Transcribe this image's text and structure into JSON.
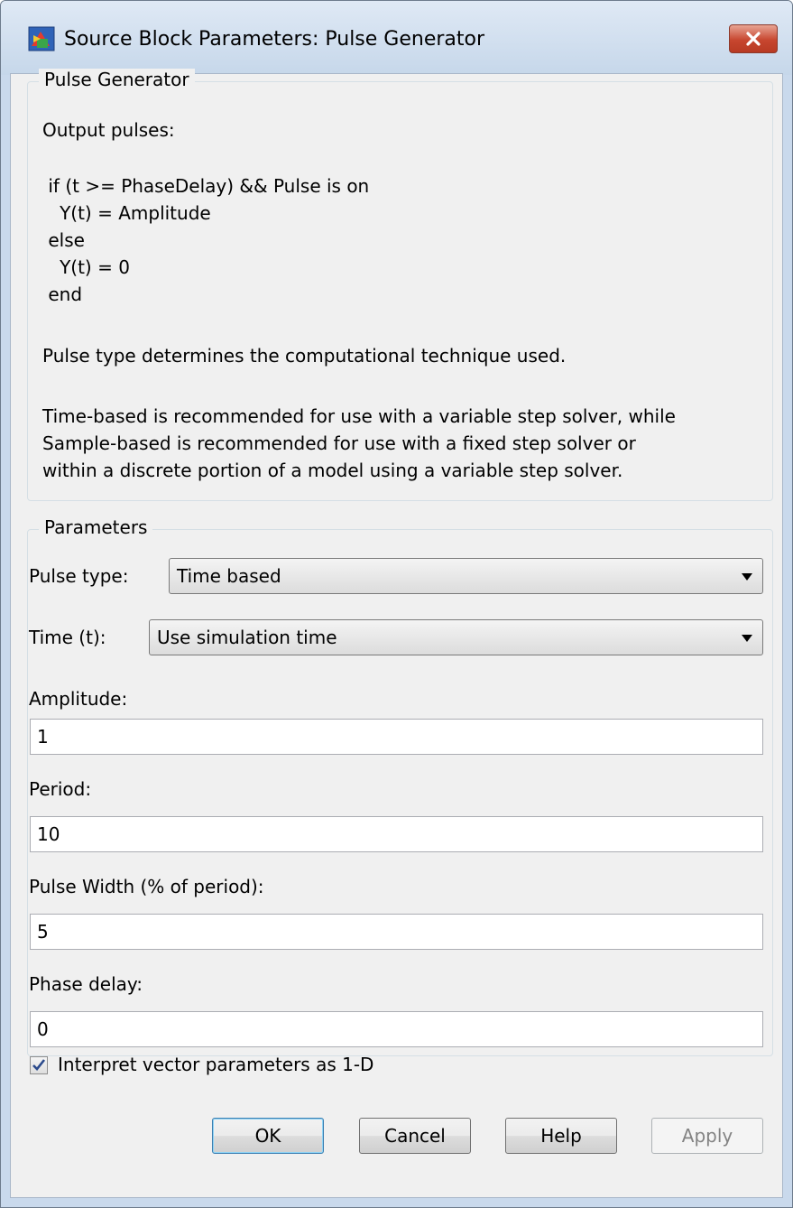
{
  "window": {
    "title": "Source Block Parameters: Pulse Generator",
    "close_icon": "close-x-icon",
    "app_icon": "simulink-block-icon"
  },
  "description": {
    "legend": "Pulse Generator",
    "intro": "Output pulses:",
    "code_lines": [
      " if (t >= PhaseDelay) && Pulse is on",
      "   Y(t) = Amplitude",
      " else",
      "   Y(t) = 0",
      " end"
    ],
    "pulse_type_note": "Pulse type determines the computational technique used.",
    "recommend_lines": [
      "Time-based is recommended for use with a variable step solver, while",
      "Sample-based is recommended for use with a fixed step solver or",
      "within a discrete portion of a model using a variable step solver."
    ]
  },
  "parameters": {
    "legend": "Parameters",
    "pulse_type": {
      "label": "Pulse type:",
      "value": "Time based"
    },
    "time": {
      "label": "Time (t):",
      "value": "Use simulation time"
    },
    "amplitude": {
      "label": "Amplitude:",
      "value": "1"
    },
    "period": {
      "label": "Period:",
      "value": "10"
    },
    "pulse_width": {
      "label": "Pulse Width (% of period):",
      "value": "5"
    },
    "phase_delay": {
      "label": "Phase delay:",
      "value": "0"
    },
    "interpret_vector": {
      "label": "Interpret vector parameters as 1-D",
      "checked": true
    }
  },
  "buttons": {
    "ok": "OK",
    "cancel": "Cancel",
    "help": "Help",
    "apply": "Apply"
  },
  "colors": {
    "frame": "#c9d9ec",
    "client": "#f0f0f0",
    "close_button": "#c7462f",
    "checkbox_mark": "#2b4a8c"
  }
}
